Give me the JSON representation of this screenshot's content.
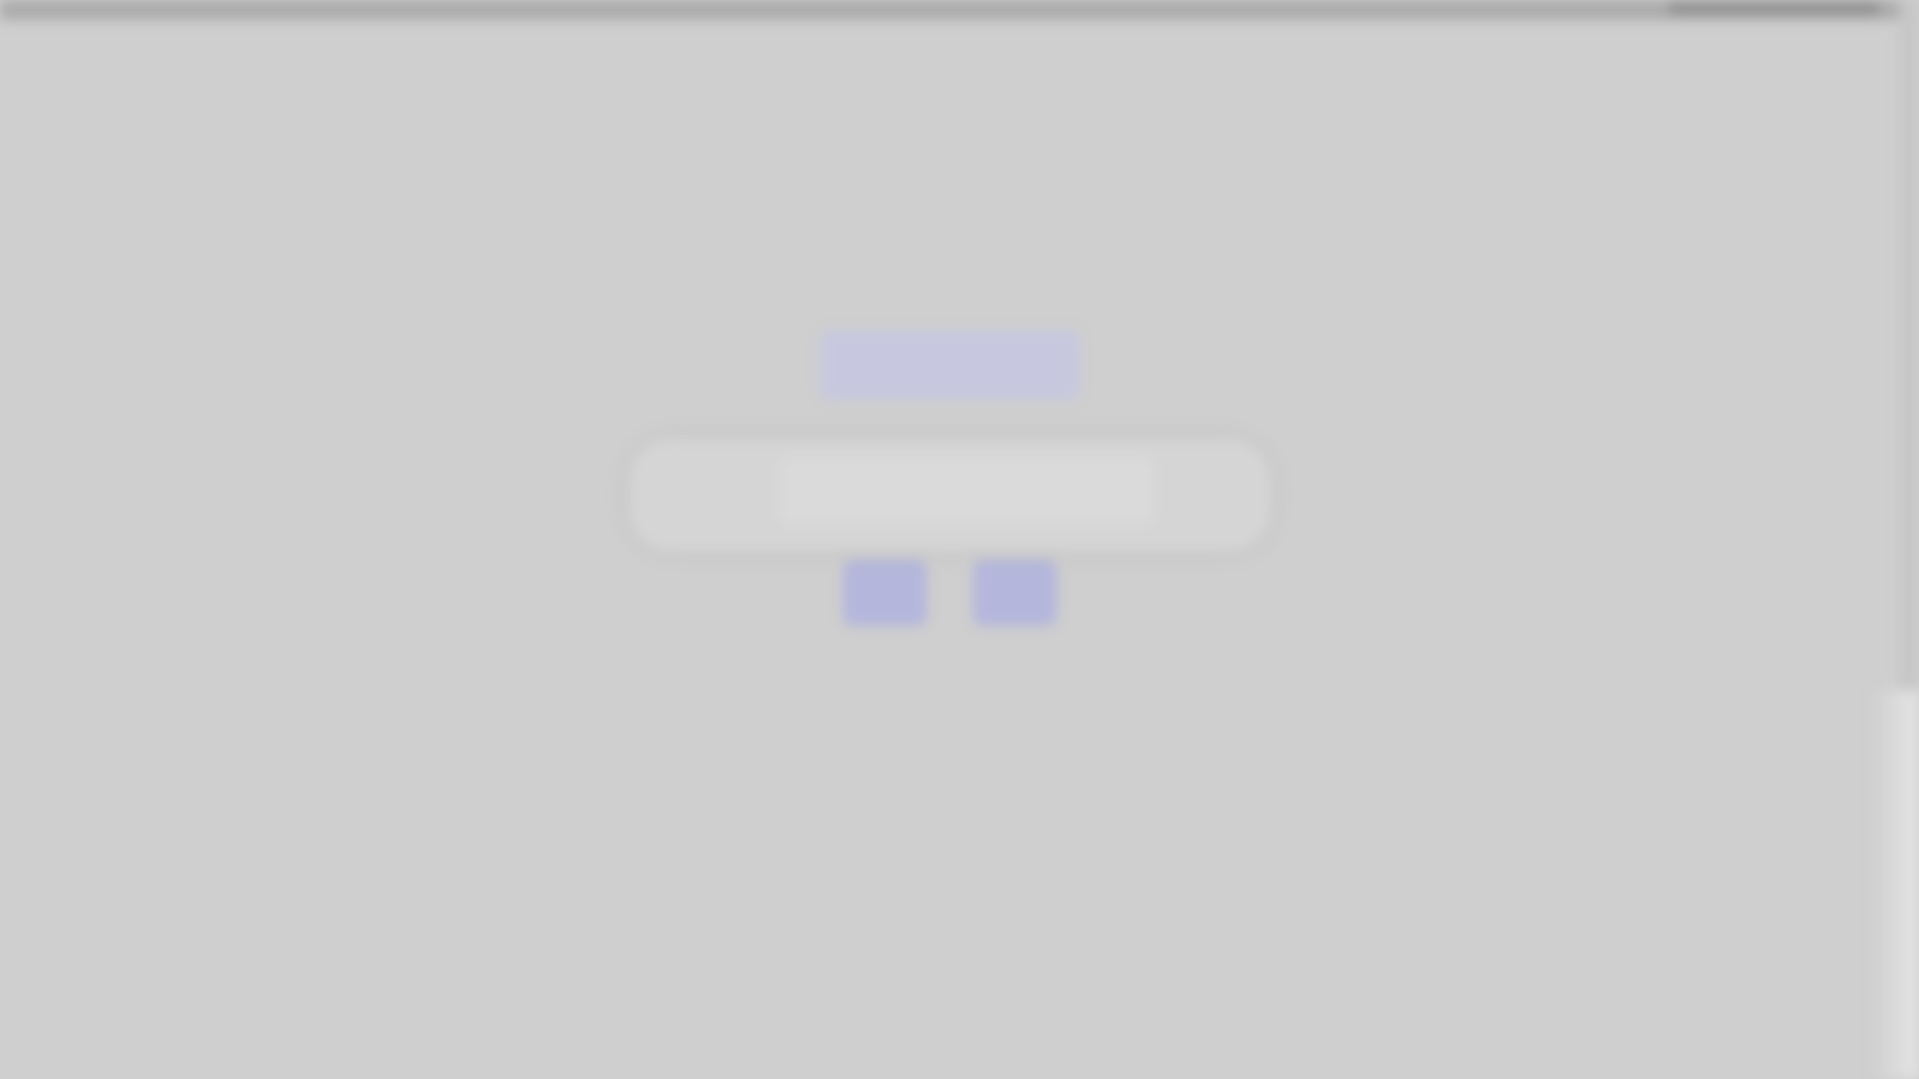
{
  "nav": {
    "items": [
      "",
      "",
      "",
      ""
    ]
  },
  "main": {
    "primary_button_label": "",
    "form": {
      "label": "",
      "input_value": "",
      "input_placeholder": ""
    },
    "buttons": [
      "",
      ""
    ]
  },
  "top_bar": {
    "right_text": ""
  },
  "colors": {
    "background": "#cfcfcf",
    "accent": "#8f94d6",
    "button_fill": "#b4b6dc"
  }
}
